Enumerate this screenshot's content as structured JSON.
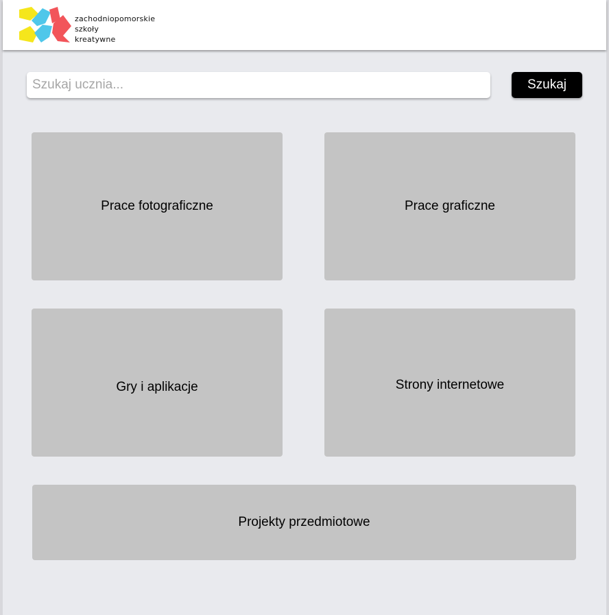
{
  "header": {
    "logo_icon": "zsk-logo-icon",
    "logo_lines": [
      "zachodniopomorskie",
      "szkoły",
      "kreatywne"
    ],
    "colors": {
      "yellow": "#f5e61c",
      "cyan": "#4fc7ea",
      "red": "#f2555a"
    }
  },
  "search": {
    "placeholder": "Szukaj ucznia...",
    "value": "",
    "button_label": "Szukaj"
  },
  "categories": [
    {
      "label": "Prace fotograficzne"
    },
    {
      "label": "Prace graficzne"
    },
    {
      "label": "Gry i aplikacje"
    },
    {
      "label": "Strony internetowe"
    },
    {
      "label": "Projekty przedmiotowe"
    }
  ]
}
